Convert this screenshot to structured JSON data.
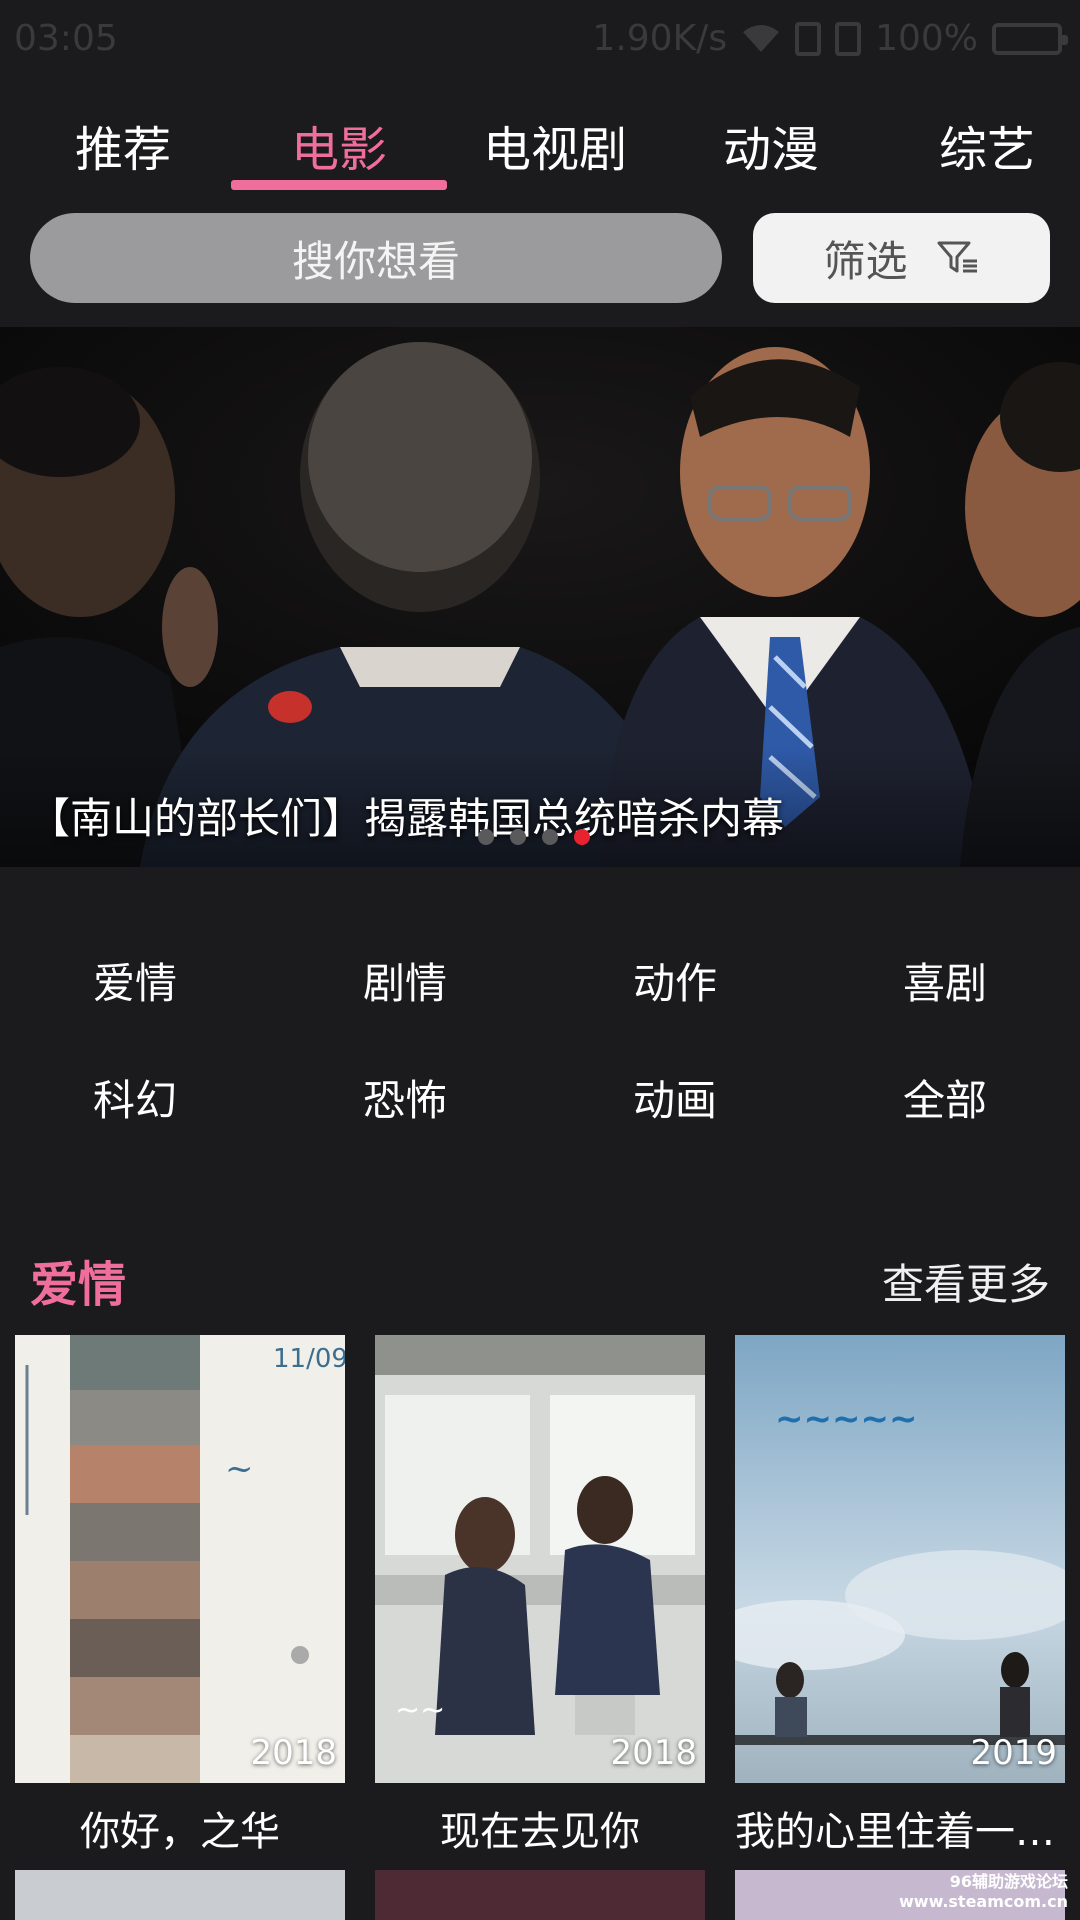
{
  "status_bar": {
    "time": "03:05",
    "network_speed": "1.90K/s",
    "battery": "100%",
    "icons": [
      "wifi-icon",
      "sim-card-icon",
      "sim-card-icon",
      "battery-icon"
    ]
  },
  "tabs": [
    {
      "label": "推荐",
      "active": false
    },
    {
      "label": "电影",
      "active": true
    },
    {
      "label": "电视剧",
      "active": false
    },
    {
      "label": "动漫",
      "active": false
    },
    {
      "label": "综艺",
      "active": false
    }
  ],
  "search": {
    "placeholder": "搜你想看"
  },
  "filter": {
    "label": "筛选",
    "icon": "filter-icon"
  },
  "banner": {
    "caption": "【南山的部长们】揭露韩国总统暗杀内幕",
    "slide_count": 4,
    "active_slide": 4
  },
  "categories": [
    "爱情",
    "剧情",
    "动作",
    "喜剧",
    "科幻",
    "恐怖",
    "动画",
    "全部"
  ],
  "section": {
    "title": "爱情",
    "more_label": "查看更多",
    "movies": [
      {
        "title": "你好，之华",
        "year": "2018"
      },
      {
        "title": "现在去见你",
        "year": "2018"
      },
      {
        "title": "我的心里住着一只...",
        "year": "2019"
      }
    ]
  },
  "watermark": {
    "line1": "96辅助游戏论坛",
    "line2": "www.steamcom.cn"
  },
  "colors": {
    "accent": "#ef6e9c",
    "background": "#1b1a1c",
    "dot_active": "#e8232f"
  }
}
